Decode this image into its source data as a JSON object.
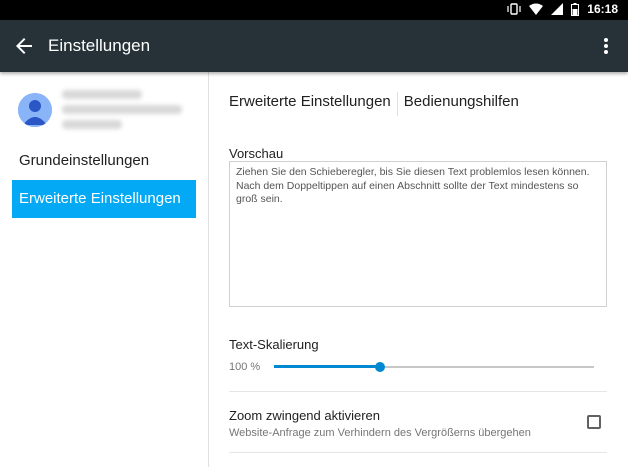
{
  "statusbar": {
    "time": "16:18",
    "icons": [
      "vibrate-icon",
      "wifi-icon",
      "signal-icon",
      "battery-icon"
    ]
  },
  "appbar": {
    "title": "Einstellungen",
    "icons": [
      "back-arrow-icon",
      "overflow-menu-icon"
    ]
  },
  "sidebar": {
    "items": [
      {
        "label": "Grundeinstellungen",
        "active": false
      },
      {
        "label": "Erweiterte Einstellungen",
        "active": true
      }
    ]
  },
  "main": {
    "tabs": [
      "Erweiterte Einstellungen",
      "Bedienungshilfen"
    ],
    "preview": {
      "label": "Vorschau",
      "text": "Ziehen Sie den Schieberegler, bis Sie diesen Text problemlos lesen können. Nach dem Doppeltippen auf einen Abschnitt sollte der Text mindestens so groß sein."
    },
    "text_scaling": {
      "label": "Text-Skalierung",
      "value_text": "100 %",
      "slider_fraction": 0.33
    },
    "force_zoom": {
      "title": "Zoom zwingend aktivieren",
      "subtitle": "Website-Anfrage zum Verhindern des Vergrößerns übergehen",
      "checked": false
    }
  },
  "colors": {
    "appbar": "#263238",
    "accent": "#03a9f4",
    "slider": "#0288d1"
  }
}
